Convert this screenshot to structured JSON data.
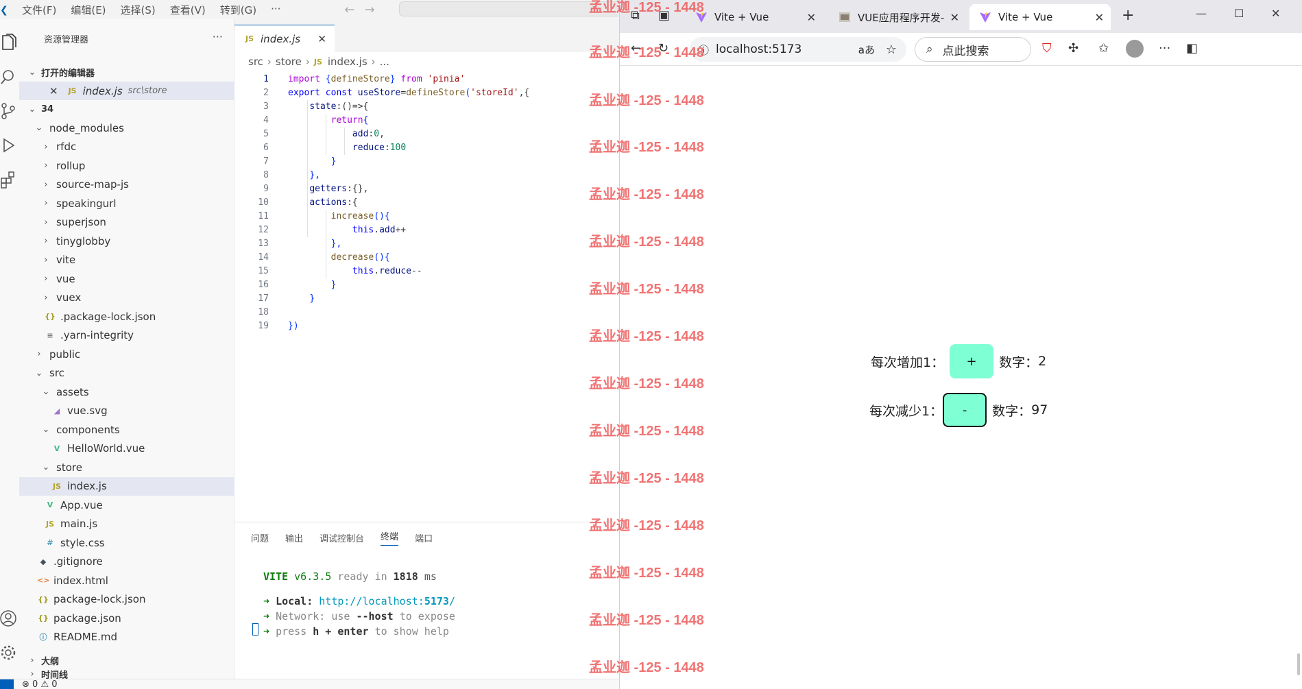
{
  "vscode": {
    "menu": [
      "文件(F)",
      "编辑(E)",
      "选择(S)",
      "查看(V)",
      "转到(G)",
      "···"
    ],
    "sidebar": {
      "title": "资源管理器",
      "more": "···",
      "open_editors_label": "打开的编辑器",
      "open_editor": {
        "name": "index.js",
        "path": "src\\store"
      },
      "root": "34",
      "tree": [
        {
          "name": "node_modules",
          "type": "folder-open",
          "indent": 1
        },
        {
          "name": "rfdc",
          "type": "folder",
          "indent": 2
        },
        {
          "name": "rollup",
          "type": "folder",
          "indent": 2
        },
        {
          "name": "source-map-js",
          "type": "folder",
          "indent": 2
        },
        {
          "name": "speakingurl",
          "type": "folder",
          "indent": 2
        },
        {
          "name": "superjson",
          "type": "folder",
          "indent": 2
        },
        {
          "name": "tinyglobby",
          "type": "folder",
          "indent": 2
        },
        {
          "name": "vite",
          "type": "folder",
          "indent": 2
        },
        {
          "name": "vue",
          "type": "folder",
          "indent": 2
        },
        {
          "name": "vuex",
          "type": "folder",
          "indent": 2
        },
        {
          "name": ".package-lock.json",
          "type": "json",
          "indent": 2
        },
        {
          "name": ".yarn-integrity",
          "type": "yarn",
          "indent": 2
        },
        {
          "name": "public",
          "type": "folder",
          "indent": 1
        },
        {
          "name": "src",
          "type": "folder-open",
          "indent": 1
        },
        {
          "name": "assets",
          "type": "folder-open",
          "indent": 2
        },
        {
          "name": "vue.svg",
          "type": "svg",
          "indent": 3
        },
        {
          "name": "components",
          "type": "folder-open",
          "indent": 2
        },
        {
          "name": "HelloWorld.vue",
          "type": "vue",
          "indent": 3
        },
        {
          "name": "store",
          "type": "folder-open",
          "indent": 2
        },
        {
          "name": "index.js",
          "type": "js",
          "indent": 3,
          "selected": true
        },
        {
          "name": "App.vue",
          "type": "vue",
          "indent": 2
        },
        {
          "name": "main.js",
          "type": "js",
          "indent": 2
        },
        {
          "name": "style.css",
          "type": "css",
          "indent": 2
        },
        {
          "name": ".gitignore",
          "type": "git",
          "indent": 1
        },
        {
          "name": "index.html",
          "type": "html",
          "indent": 1
        },
        {
          "name": "package-lock.json",
          "type": "json",
          "indent": 1
        },
        {
          "name": "package.json",
          "type": "json",
          "indent": 1
        },
        {
          "name": "README.md",
          "type": "info",
          "indent": 1
        }
      ],
      "outline_label": "大纲",
      "timeline_label": "时间线"
    },
    "editor": {
      "tab_name": "index.js",
      "tab_icon": "JS",
      "breadcrumbs": [
        "src",
        "store",
        "index.js",
        "..."
      ],
      "current_line": 1,
      "lines": [
        "import {defineStore} from 'pinia'",
        "export const useStore=defineStore('storeId',{",
        "    state:()=>{",
        "        return{",
        "            add:0,",
        "            reduce:100",
        "        }",
        "    },",
        "    getters:{},",
        "    actions:{",
        "        increase(){",
        "            this.add++",
        "        },",
        "        decrease(){",
        "            this.reduce--",
        "        }",
        "    }",
        "",
        "})"
      ]
    },
    "panel": {
      "tabs": [
        "问题",
        "输出",
        "调试控制台",
        "终端",
        "端口"
      ],
      "active_tab": "终端",
      "terminal": {
        "vite": "VITE",
        "version": "v6.3.5",
        "ready": "ready in",
        "ms_value": "1818",
        "ms": "ms",
        "local_label": "Local:",
        "local_url_prefix": "http://localhost:",
        "local_port": "5173",
        "local_url_suffix": "/",
        "network_label": "Network:",
        "network_text_a": "use",
        "network_flag": "--host",
        "network_text_b": "to expose",
        "press": "press",
        "help_key": "h + enter",
        "help_text": "to show help"
      }
    },
    "status": {
      "errors": "0",
      "warnings": "0"
    }
  },
  "browser": {
    "tabs": [
      {
        "title": "Vite + Vue",
        "active": false
      },
      {
        "title": "VUE应用程序开发-",
        "active": false
      },
      {
        "title": "Vite + Vue",
        "active": true
      }
    ],
    "url": "localhost:5173",
    "search_placeholder": "点此搜索",
    "page": {
      "increase_label": "每次增加1：",
      "increase_button": "+",
      "increase_value_label": "数字：",
      "increase_value": "2",
      "decrease_label": "每次减少1：",
      "decrease_button": "-",
      "decrease_value_label": "数字：",
      "decrease_value": "97"
    }
  },
  "watermark": "孟业迦 -125 - 1448"
}
